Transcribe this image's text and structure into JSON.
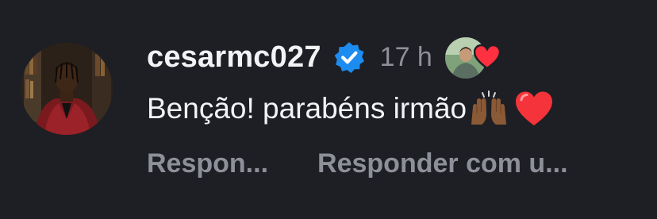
{
  "comment": {
    "username": "cesarmc027",
    "verified": true,
    "time": "17 h",
    "text": "Benção! parabéns irmão",
    "emojis": [
      "raising-hands-icon",
      "red-heart-icon"
    ],
    "liked_by_author": true,
    "actions": {
      "reply": "Respon...",
      "reply_with": "Responder com u..."
    }
  },
  "colors": {
    "background": "#1e1f24",
    "primary_text": "#f2f3f5",
    "secondary_text": "#8e9099",
    "verified_blue": "#1d8cf0",
    "heart_red": "#ff3040"
  }
}
